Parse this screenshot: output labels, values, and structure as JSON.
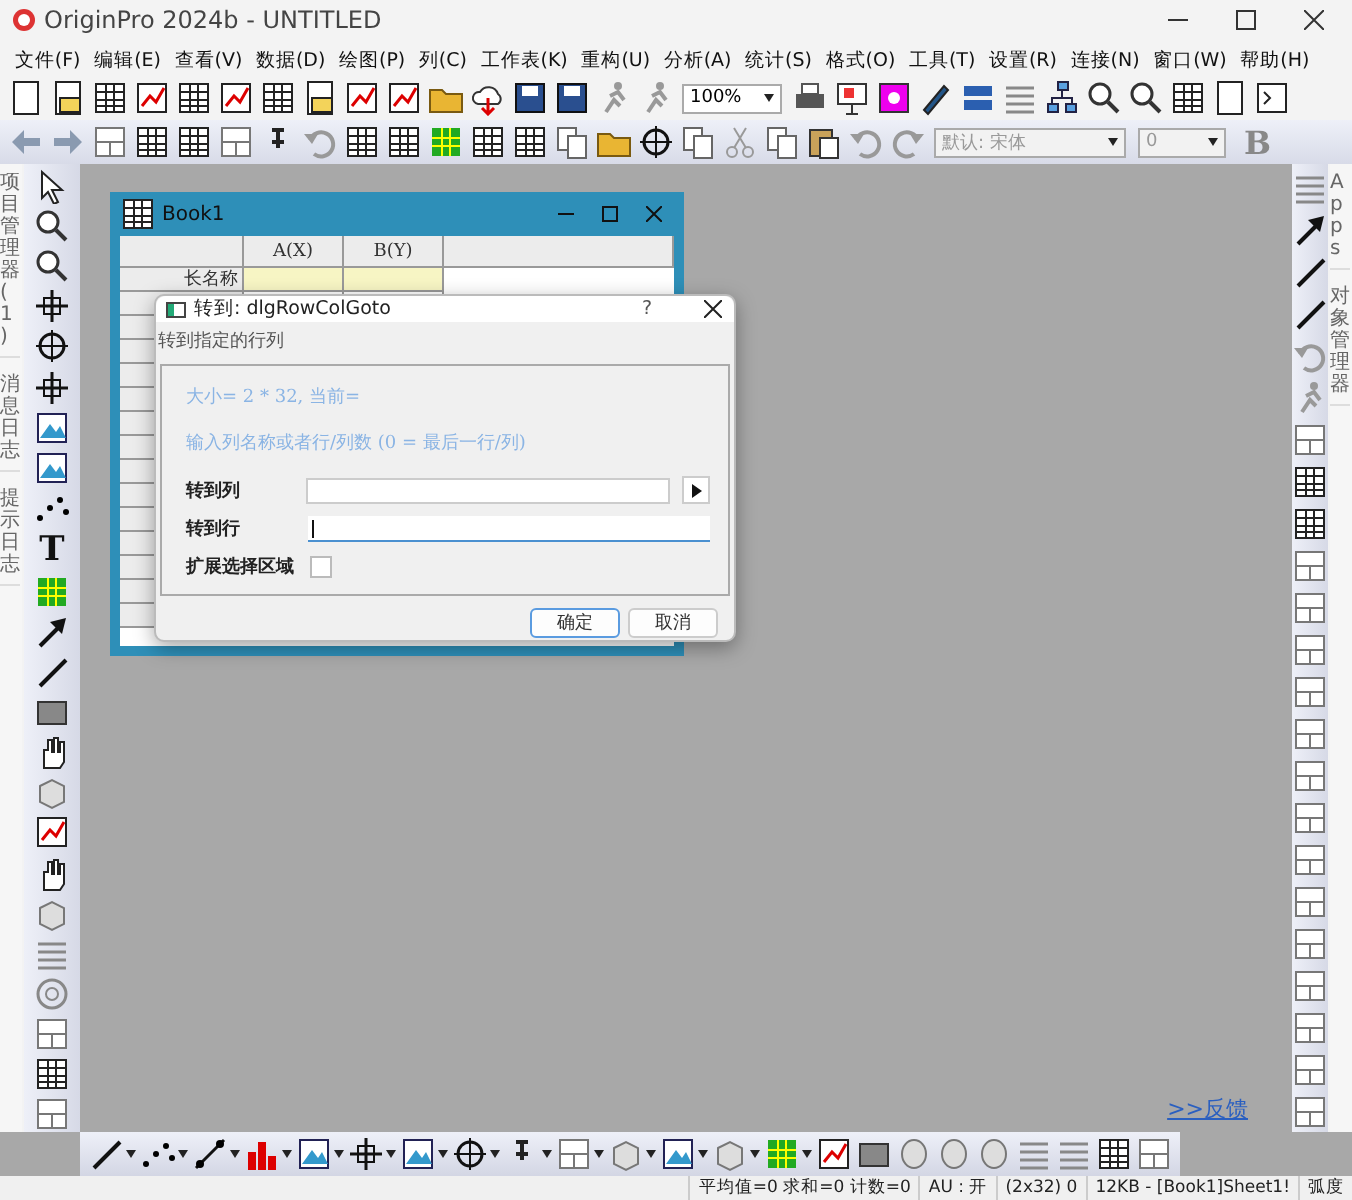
{
  "window": {
    "title": "OriginPro 2024b - UNTITLED"
  },
  "menu": [
    "文件(F)",
    "编辑(E)",
    "查看(V)",
    "数据(D)",
    "绘图(P)",
    "列(C)",
    "工作表(K)",
    "重构(U)",
    "分析(A)",
    "统计(S)",
    "格式(O)",
    "工具(T)",
    "设置(R)",
    "连接(N)",
    "窗口(W)",
    "帮助(H)"
  ],
  "toolbar": {
    "zoom": "100%",
    "font": "默认: 宋体",
    "font_size": "0",
    "bold": "B"
  },
  "left_tabs": [
    "项目管理器 (1)",
    "消息日志",
    "提示日志"
  ],
  "left_tools": {
    "text_tool": "T"
  },
  "right_tabs": [
    "Apps",
    "对象管理器"
  ],
  "workbook": {
    "title": "Book1",
    "columns": [
      "A(X)",
      "B(Y)"
    ],
    "row_label": "长名称"
  },
  "dialog": {
    "title": "转到: dlgRowColGoto",
    "help": "?",
    "subtitle": "转到指定的行列",
    "info": [
      "大小= 2 * 32, 当前=",
      "输入列名称或者行/列数 (0 = 最后一行/列)"
    ],
    "fields": [
      {
        "kind": "picker",
        "label": "转到列",
        "focused": false
      },
      {
        "kind": "text",
        "label": "转到行",
        "focused": true
      },
      {
        "kind": "checkbox",
        "label": "扩展选择区域",
        "checked": false
      }
    ],
    "buttons": [
      {
        "label": "确定",
        "default": true
      },
      {
        "label": "取消",
        "default": false
      }
    ]
  },
  "feedback_link": ">>反馈",
  "status_bar": [
    "平均值=0 求和=0 计数=0",
    "AU : 开",
    "(2x32) 0",
    "12KB - [Book1]Sheet1!",
    "弧度"
  ]
}
